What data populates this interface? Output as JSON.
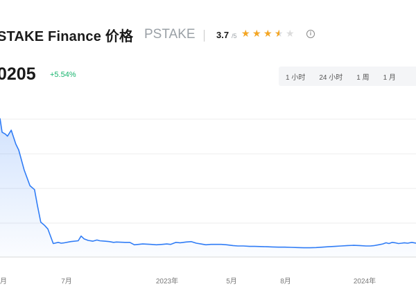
{
  "header": {
    "title": "STAKE Finance 价格",
    "symbol": "PSTAKE",
    "rating_value": "3.7",
    "rating_scale": "/5",
    "rating_stars": [
      1,
      1,
      1,
      0.5,
      0
    ],
    "star_color": "#f5a623",
    "info_icon": "info-icon"
  },
  "price": {
    "value": "0205",
    "change": "+5.54%",
    "change_color": "#16b46d"
  },
  "time_tabs": [
    "1 小时",
    "24 小时",
    "1 周",
    "1 月"
  ],
  "chart_data": {
    "type": "area",
    "title": "",
    "xlabel": "",
    "ylabel": "",
    "grid": true,
    "line_color": "#2f7cf6",
    "x_tick_labels": [
      "月",
      "7月",
      "2023年",
      "5月",
      "8月",
      "2024年"
    ],
    "series": [
      {
        "values": [
          [
            0.0,
            0.39
          ],
          [
            0.5,
            0.355
          ],
          [
            1.3,
            0.35
          ],
          [
            1.8,
            0.345
          ],
          [
            2.7,
            0.36
          ],
          [
            3.8,
            0.325
          ],
          [
            4.5,
            0.31
          ],
          [
            5.8,
            0.26
          ],
          [
            7.2,
            0.22
          ],
          [
            8.3,
            0.21
          ],
          [
            9.0,
            0.17
          ],
          [
            9.8,
            0.128
          ],
          [
            10.7,
            0.12
          ],
          [
            11.5,
            0.111
          ],
          [
            12.8,
            0.074
          ],
          [
            14.0,
            0.077
          ],
          [
            14.7,
            0.075
          ],
          [
            15.5,
            0.076
          ],
          [
            17.0,
            0.079
          ],
          [
            18.8,
            0.081
          ],
          [
            19.5,
            0.093
          ],
          [
            20.2,
            0.086
          ],
          [
            21.2,
            0.082
          ],
          [
            22.3,
            0.08
          ],
          [
            23.3,
            0.083
          ],
          [
            24.0,
            0.081
          ],
          [
            25.2,
            0.08
          ],
          [
            26.3,
            0.079
          ],
          [
            27.3,
            0.077
          ],
          [
            28.0,
            0.078
          ],
          [
            30.0,
            0.077
          ],
          [
            31.2,
            0.077
          ],
          [
            32.3,
            0.071
          ],
          [
            33.3,
            0.072
          ],
          [
            34.3,
            0.073
          ],
          [
            36.3,
            0.072
          ],
          [
            37.6,
            0.071
          ],
          [
            39.0,
            0.072
          ],
          [
            40.1,
            0.073
          ],
          [
            41.0,
            0.072
          ],
          [
            42.3,
            0.077
          ],
          [
            43.3,
            0.076
          ],
          [
            44.7,
            0.078
          ],
          [
            46.0,
            0.079
          ],
          [
            47.2,
            0.075
          ],
          [
            48.3,
            0.073
          ],
          [
            49.5,
            0.071
          ],
          [
            50.7,
            0.072
          ],
          [
            52.0,
            0.072
          ],
          [
            53.2,
            0.072
          ],
          [
            54.5,
            0.071
          ],
          [
            56.0,
            0.069
          ],
          [
            57.2,
            0.068
          ],
          [
            58.5,
            0.068
          ],
          [
            60.0,
            0.067
          ],
          [
            61.2,
            0.067
          ],
          [
            62.5,
            0.0665
          ],
          [
            64.0,
            0.066
          ],
          [
            65.5,
            0.0655
          ],
          [
            67.0,
            0.065
          ],
          [
            68.5,
            0.065
          ],
          [
            70.0,
            0.0645
          ],
          [
            71.5,
            0.064
          ],
          [
            73.0,
            0.0635
          ],
          [
            74.5,
            0.0635
          ],
          [
            76.0,
            0.064
          ],
          [
            77.5,
            0.065
          ],
          [
            79.0,
            0.066
          ],
          [
            80.5,
            0.067
          ],
          [
            82.0,
            0.068
          ],
          [
            83.5,
            0.069
          ],
          [
            85.0,
            0.0695
          ],
          [
            86.5,
            0.069
          ],
          [
            88.0,
            0.068
          ],
          [
            89.0,
            0.068
          ],
          [
            90.0,
            0.069
          ],
          [
            91.0,
            0.071
          ],
          [
            92.0,
            0.073
          ],
          [
            92.8,
            0.076
          ],
          [
            93.5,
            0.074
          ],
          [
            94.3,
            0.077
          ],
          [
            95.0,
            0.076
          ],
          [
            95.8,
            0.074
          ],
          [
            96.5,
            0.075
          ],
          [
            97.2,
            0.076
          ],
          [
            98.0,
            0.075
          ],
          [
            99.0,
            0.077
          ],
          [
            100.0,
            0.075
          ]
        ]
      }
    ]
  }
}
